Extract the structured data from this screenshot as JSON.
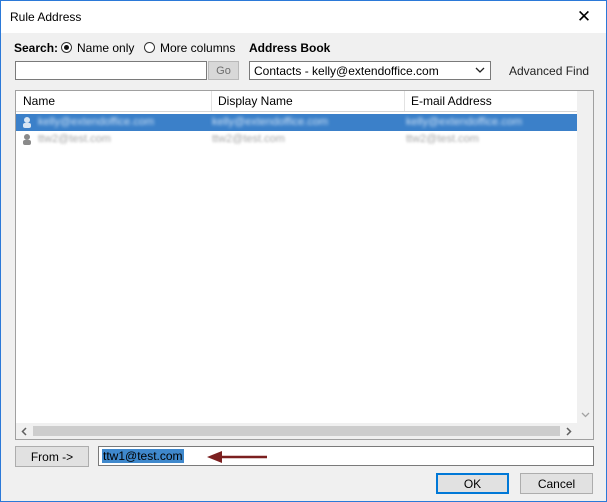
{
  "window": {
    "title": "Rule Address",
    "close_glyph": "✕"
  },
  "search": {
    "label": "Search:",
    "option_name_only": "Name only",
    "option_more_columns": "More columns",
    "selected": "Name only",
    "input_value": "",
    "go_label": "Go"
  },
  "address_book": {
    "label": "Address Book",
    "selected": "Contacts - kelly@extendoffice.com",
    "advanced_find": "Advanced Find"
  },
  "list": {
    "columns": [
      "Name",
      "Display Name",
      "E-mail Address"
    ],
    "rows": [
      {
        "name": "kelly@extendoffice.com",
        "display": "kelly@extendoffice.com",
        "email": "kelly@extendoffice.com",
        "selected": true
      },
      {
        "name": "ttw2@test.com",
        "display": "ttw2@test.com",
        "email": "ttw2@test.com",
        "selected": false
      }
    ]
  },
  "from": {
    "button_label": "From ->",
    "value": "ttw1@test.com"
  },
  "footer": {
    "ok_label": "OK",
    "cancel_label": "Cancel"
  },
  "colors": {
    "window_border": "#2b79d8",
    "selection": "#3b80c9",
    "annotation_arrow": "#7b1f1f",
    "default_button_border": "#0078d7"
  },
  "icons": [
    "close-icon",
    "chevron-down-icon",
    "contact-icon",
    "scroll-down-arrow-icon",
    "scroll-left-arrow-icon",
    "scroll-right-arrow-icon",
    "annotation-arrow-icon"
  ]
}
